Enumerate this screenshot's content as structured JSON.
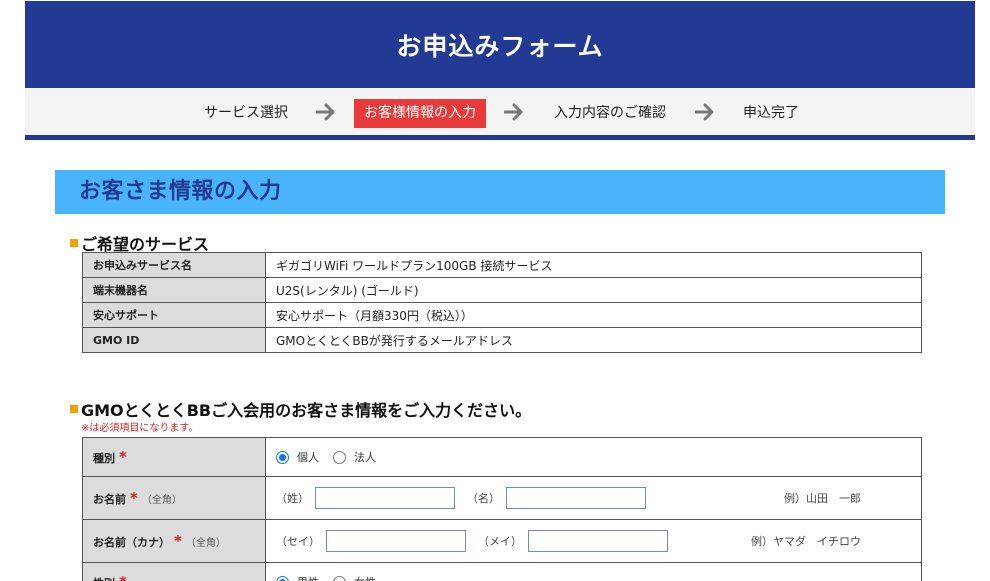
{
  "header": {
    "title": "お申込みフォーム"
  },
  "steps": [
    {
      "label": "サービス選択"
    },
    {
      "label": "お客様情報の入力"
    },
    {
      "label": "入力内容のご確認"
    },
    {
      "label": "申込完了"
    }
  ],
  "section_title": "お客さま情報の入力",
  "service": {
    "heading": "ご希望のサービス",
    "rows": [
      {
        "label": "お申込みサービス名",
        "value": "ギガゴリWiFi ワールドプラン100GB 接続サービス"
      },
      {
        "label": "端末機器名",
        "value": "U2S(レンタル) (ゴールド)"
      },
      {
        "label": "安心サポート",
        "value": "安心サポート（月額330円（税込））"
      },
      {
        "label": "GMO ID",
        "value": "GMOとくとくBBが発行するメールアドレス"
      }
    ]
  },
  "customer": {
    "heading": "GMOとくとくBBご入会用のお客さま情報をご入力ください。",
    "required_note": "※は必須項目になります。",
    "required_mark": "*",
    "type": {
      "label": "種別",
      "options": [
        {
          "label": "個人",
          "checked": true
        },
        {
          "label": "法人",
          "checked": false
        }
      ]
    },
    "name": {
      "label": "お名前",
      "note": "（全角）",
      "last_label": "（姓）",
      "first_label": "（名）",
      "last_value": "",
      "first_value": "",
      "example": "例）山田　一郎"
    },
    "kana": {
      "label": "お名前（カナ）",
      "note": "（全角）",
      "last_label": "（セイ）",
      "first_label": "（メイ）",
      "last_value": "",
      "first_value": "",
      "example": "例）ヤマダ　イチロウ"
    },
    "gender": {
      "label": "性別",
      "options": [
        {
          "label": "男性",
          "checked": true
        },
        {
          "label": "女性",
          "checked": false
        }
      ]
    }
  }
}
